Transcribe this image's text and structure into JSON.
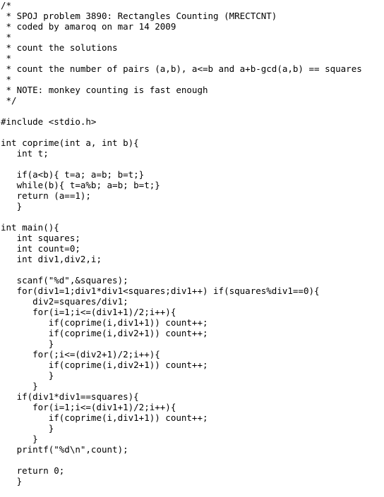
{
  "document": {
    "lines": [
      "/*",
      " * SPOJ problem 3890: Rectangles Counting (MRECTCNT)",
      " * coded by amaroq on mar 14 2009",
      " *",
      " * count the solutions",
      " *",
      " * count the number of pairs (a,b), a<=b and a+b-gcd(a,b) == squares",
      " *",
      " * NOTE: monkey counting is fast enough",
      " */",
      "",
      "#include <stdio.h>",
      "",
      "int coprime(int a, int b){",
      "   int t;",
      "",
      "   if(a<b){ t=a; a=b; b=t;}",
      "   while(b){ t=a%b; a=b; b=t;}",
      "   return (a==1);",
      "   }",
      "",
      "int main(){",
      "   int squares;",
      "   int count=0;",
      "   int div1,div2,i;",
      "",
      "   scanf(\"%d\",&squares);",
      "   for(div1=1;div1*div1<squares;div1++) if(squares%div1==0){",
      "      div2=squares/div1;",
      "      for(i=1;i<=(div1+1)/2;i++){",
      "         if(coprime(i,div1+1)) count++;",
      "         if(coprime(i,div2+1)) count++;",
      "         }",
      "      for(;i<=(div2+1)/2;i++){",
      "         if(coprime(i,div2+1)) count++;",
      "         }",
      "      }",
      "   if(div1*div1==squares){",
      "      for(i=1;i<=(div1+1)/2;i++){",
      "         if(coprime(i,div1+1)) count++;",
      "         }",
      "      }",
      "   printf(\"%d\\n\",count);",
      "",
      "   return 0;",
      "   }"
    ]
  }
}
